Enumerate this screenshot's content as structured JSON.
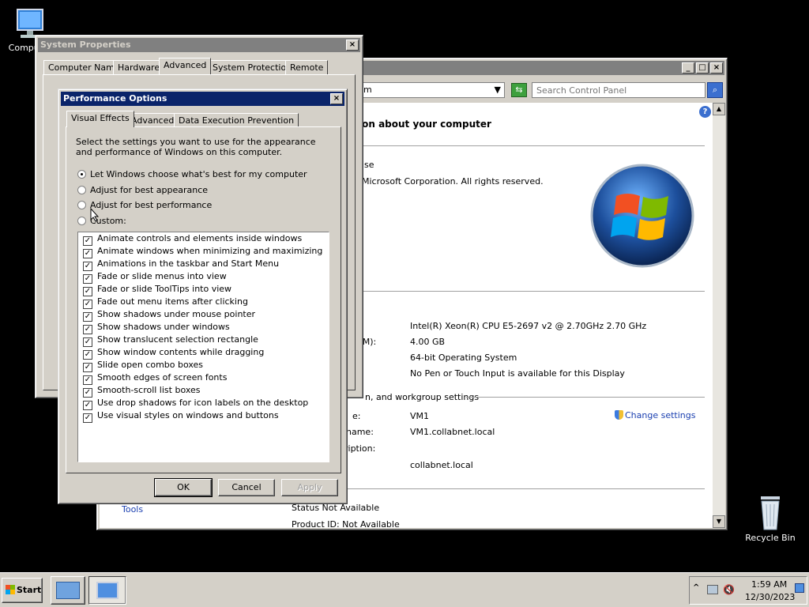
{
  "desktop": {
    "computer_label": "Computer",
    "recycle_label": "Recycle Bin"
  },
  "control_panel": {
    "breadcrumb_fragment": "m",
    "search_placeholder": "Search Control Panel",
    "heading": "ion about your computer",
    "edition_fragment": "ise",
    "copyright": "Microsoft Corporation.  All rights reserved.",
    "system": {
      "processor": "Intel(R) Xeon(R) CPU E5-2697 v2 @ 2.70GHz   2.70 GHz",
      "ram_label_fragment": "RAM):",
      "ram": "4.00 GB",
      "system_type": "64-bit Operating System",
      "pen_touch": "No Pen or Touch Input is available for this Display"
    },
    "name_section_header": "n, and workgroup settings",
    "computer_name_label_fragment": "e:",
    "computer_name": "VM1",
    "full_name_label_fragment": "name:",
    "full_name": "VM1.collabnet.local",
    "description_label_fragment": "ription:",
    "domain": "collabnet.local",
    "change_settings": "Change settings",
    "tools_link": "Tools",
    "activation_status": "Status Not Available",
    "product_id": "Product ID:  Not Available"
  },
  "system_properties": {
    "title": "System Properties",
    "tabs": [
      "Computer Name",
      "Hardware",
      "Advanced",
      "System Protection",
      "Remote"
    ]
  },
  "performance_options": {
    "title": "Performance Options",
    "tabs": [
      "Visual Effects",
      "Advanced",
      "Data Execution Prevention"
    ],
    "description": "Select the settings you want to use for the appearance and performance of Windows on this computer.",
    "radios": [
      {
        "label": "Let Windows choose what's best for my computer",
        "checked": true
      },
      {
        "label": "Adjust for best appearance",
        "checked": false
      },
      {
        "label": "Adjust for best performance",
        "checked": false
      },
      {
        "label": "Custom:",
        "checked": false
      }
    ],
    "effects": [
      "Animate controls and elements inside windows",
      "Animate windows when minimizing and maximizing",
      "Animations in the taskbar and Start Menu",
      "Fade or slide menus into view",
      "Fade or slide ToolTips into view",
      "Fade out menu items after clicking",
      "Show shadows under mouse pointer",
      "Show shadows under windows",
      "Show translucent selection rectangle",
      "Show window contents while dragging",
      "Slide open combo boxes",
      "Smooth edges of screen fonts",
      "Smooth-scroll list boxes",
      "Use drop shadows for icon labels on the desktop",
      "Use visual styles on windows and buttons"
    ],
    "ok": "OK",
    "cancel": "Cancel",
    "apply": "Apply"
  },
  "taskbar": {
    "start_label": "Start",
    "time": "1:59 AM",
    "date": "12/30/2023"
  },
  "colors": {
    "desktop": "#000000",
    "titlebar_active": "#0a246a",
    "titlebar_inactive": "#808080",
    "window_face": "#d4d0c8",
    "link": "#1a3fb0"
  }
}
